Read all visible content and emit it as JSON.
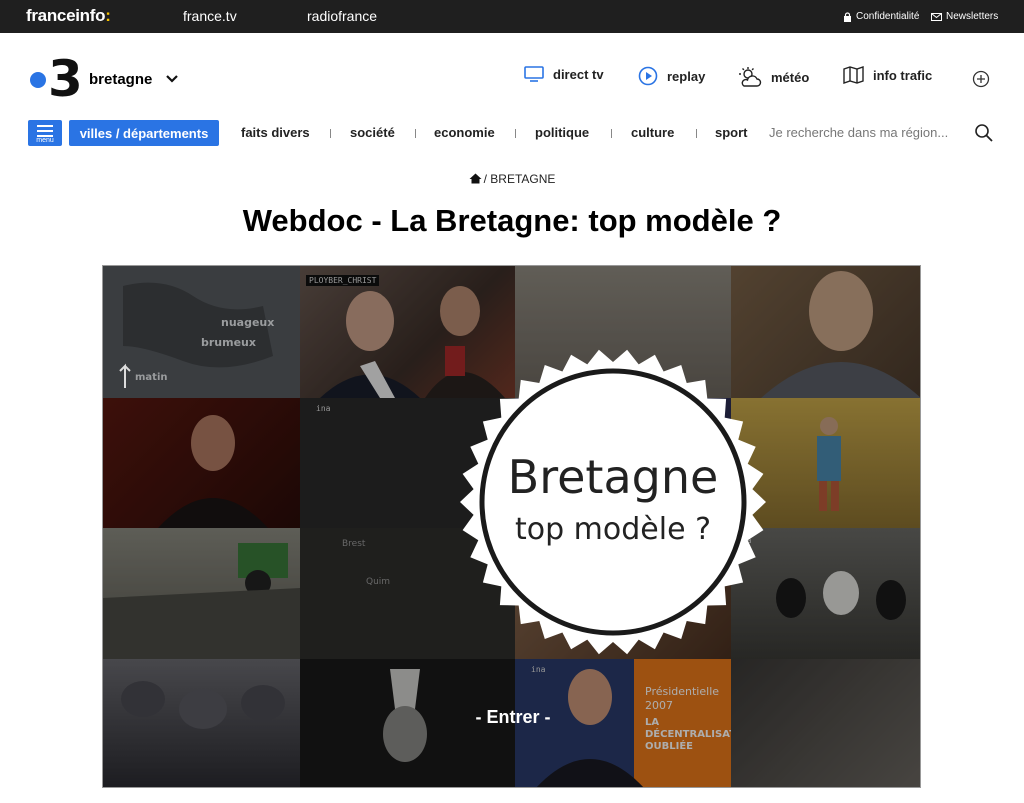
{
  "topbar": {
    "brand": "franceinfo",
    "brand_suffix": ":",
    "links": [
      "france.tv",
      "radiofrance"
    ],
    "privacy": "Confidentialité",
    "newsletters": "Newsletters"
  },
  "header": {
    "logo_number": "3",
    "region": "bretagne",
    "services": [
      {
        "label": "direct tv",
        "icon": "tv-icon"
      },
      {
        "label": "replay",
        "icon": "play-icon"
      },
      {
        "label": "météo",
        "icon": "weather-icon"
      },
      {
        "label": "info trafic",
        "icon": "map-icon"
      }
    ]
  },
  "nav": {
    "menu_label": "menu",
    "villes_label": "villes / départements",
    "items": [
      "faits divers",
      "société",
      "economie",
      "politique",
      "culture",
      "sport"
    ],
    "search_placeholder": "Je recherche dans ma région..."
  },
  "breadcrumb": {
    "separator": "/",
    "label": "BRETAGNE"
  },
  "page": {
    "title": "Webdoc - La Bretagne: top modèle ?"
  },
  "webdoc": {
    "title_line1": "Bretagne",
    "title_line2": "top modèle ?",
    "enter_label": "- Entrer -",
    "tile_captions": {
      "weather_1": "nuageux",
      "weather_2": "brumeux",
      "weather_3": "matin",
      "tv_tag": "PLOYBER_CHRIST",
      "map_city_1": "Brest",
      "map_city_2": "Quim",
      "presidential_1": "Présidentielle",
      "presidential_2": "2007",
      "presidential_3": "LA",
      "presidential_4": "DÉCENTRALISATION",
      "presidential_5": "OUBLIÉE",
      "ina": "ina"
    }
  },
  "colors": {
    "accent": "#2a74e4",
    "topbar": "#1f1f1f",
    "brand_dot": "#f7c300"
  }
}
